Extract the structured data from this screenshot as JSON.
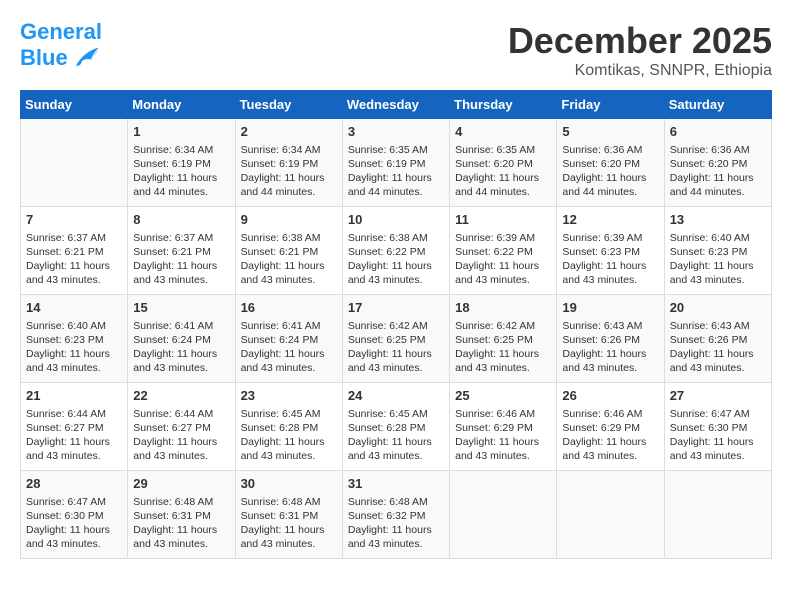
{
  "logo": {
    "line1": "General",
    "line2": "Blue"
  },
  "title": "December 2025",
  "location": "Komtikas, SNNPR, Ethiopia",
  "days_header": [
    "Sunday",
    "Monday",
    "Tuesday",
    "Wednesday",
    "Thursday",
    "Friday",
    "Saturday"
  ],
  "weeks": [
    [
      {
        "num": "",
        "info": ""
      },
      {
        "num": "1",
        "info": "Sunrise: 6:34 AM\nSunset: 6:19 PM\nDaylight: 11 hours and 44 minutes."
      },
      {
        "num": "2",
        "info": "Sunrise: 6:34 AM\nSunset: 6:19 PM\nDaylight: 11 hours and 44 minutes."
      },
      {
        "num": "3",
        "info": "Sunrise: 6:35 AM\nSunset: 6:19 PM\nDaylight: 11 hours and 44 minutes."
      },
      {
        "num": "4",
        "info": "Sunrise: 6:35 AM\nSunset: 6:20 PM\nDaylight: 11 hours and 44 minutes."
      },
      {
        "num": "5",
        "info": "Sunrise: 6:36 AM\nSunset: 6:20 PM\nDaylight: 11 hours and 44 minutes."
      },
      {
        "num": "6",
        "info": "Sunrise: 6:36 AM\nSunset: 6:20 PM\nDaylight: 11 hours and 44 minutes."
      }
    ],
    [
      {
        "num": "7",
        "info": "Sunrise: 6:37 AM\nSunset: 6:21 PM\nDaylight: 11 hours and 43 minutes."
      },
      {
        "num": "8",
        "info": "Sunrise: 6:37 AM\nSunset: 6:21 PM\nDaylight: 11 hours and 43 minutes."
      },
      {
        "num": "9",
        "info": "Sunrise: 6:38 AM\nSunset: 6:21 PM\nDaylight: 11 hours and 43 minutes."
      },
      {
        "num": "10",
        "info": "Sunrise: 6:38 AM\nSunset: 6:22 PM\nDaylight: 11 hours and 43 minutes."
      },
      {
        "num": "11",
        "info": "Sunrise: 6:39 AM\nSunset: 6:22 PM\nDaylight: 11 hours and 43 minutes."
      },
      {
        "num": "12",
        "info": "Sunrise: 6:39 AM\nSunset: 6:23 PM\nDaylight: 11 hours and 43 minutes."
      },
      {
        "num": "13",
        "info": "Sunrise: 6:40 AM\nSunset: 6:23 PM\nDaylight: 11 hours and 43 minutes."
      }
    ],
    [
      {
        "num": "14",
        "info": "Sunrise: 6:40 AM\nSunset: 6:23 PM\nDaylight: 11 hours and 43 minutes."
      },
      {
        "num": "15",
        "info": "Sunrise: 6:41 AM\nSunset: 6:24 PM\nDaylight: 11 hours and 43 minutes."
      },
      {
        "num": "16",
        "info": "Sunrise: 6:41 AM\nSunset: 6:24 PM\nDaylight: 11 hours and 43 minutes."
      },
      {
        "num": "17",
        "info": "Sunrise: 6:42 AM\nSunset: 6:25 PM\nDaylight: 11 hours and 43 minutes."
      },
      {
        "num": "18",
        "info": "Sunrise: 6:42 AM\nSunset: 6:25 PM\nDaylight: 11 hours and 43 minutes."
      },
      {
        "num": "19",
        "info": "Sunrise: 6:43 AM\nSunset: 6:26 PM\nDaylight: 11 hours and 43 minutes."
      },
      {
        "num": "20",
        "info": "Sunrise: 6:43 AM\nSunset: 6:26 PM\nDaylight: 11 hours and 43 minutes."
      }
    ],
    [
      {
        "num": "21",
        "info": "Sunrise: 6:44 AM\nSunset: 6:27 PM\nDaylight: 11 hours and 43 minutes."
      },
      {
        "num": "22",
        "info": "Sunrise: 6:44 AM\nSunset: 6:27 PM\nDaylight: 11 hours and 43 minutes."
      },
      {
        "num": "23",
        "info": "Sunrise: 6:45 AM\nSunset: 6:28 PM\nDaylight: 11 hours and 43 minutes."
      },
      {
        "num": "24",
        "info": "Sunrise: 6:45 AM\nSunset: 6:28 PM\nDaylight: 11 hours and 43 minutes."
      },
      {
        "num": "25",
        "info": "Sunrise: 6:46 AM\nSunset: 6:29 PM\nDaylight: 11 hours and 43 minutes."
      },
      {
        "num": "26",
        "info": "Sunrise: 6:46 AM\nSunset: 6:29 PM\nDaylight: 11 hours and 43 minutes."
      },
      {
        "num": "27",
        "info": "Sunrise: 6:47 AM\nSunset: 6:30 PM\nDaylight: 11 hours and 43 minutes."
      }
    ],
    [
      {
        "num": "28",
        "info": "Sunrise: 6:47 AM\nSunset: 6:30 PM\nDaylight: 11 hours and 43 minutes."
      },
      {
        "num": "29",
        "info": "Sunrise: 6:48 AM\nSunset: 6:31 PM\nDaylight: 11 hours and 43 minutes."
      },
      {
        "num": "30",
        "info": "Sunrise: 6:48 AM\nSunset: 6:31 PM\nDaylight: 11 hours and 43 minutes."
      },
      {
        "num": "31",
        "info": "Sunrise: 6:48 AM\nSunset: 6:32 PM\nDaylight: 11 hours and 43 minutes."
      },
      {
        "num": "",
        "info": ""
      },
      {
        "num": "",
        "info": ""
      },
      {
        "num": "",
        "info": ""
      }
    ]
  ]
}
